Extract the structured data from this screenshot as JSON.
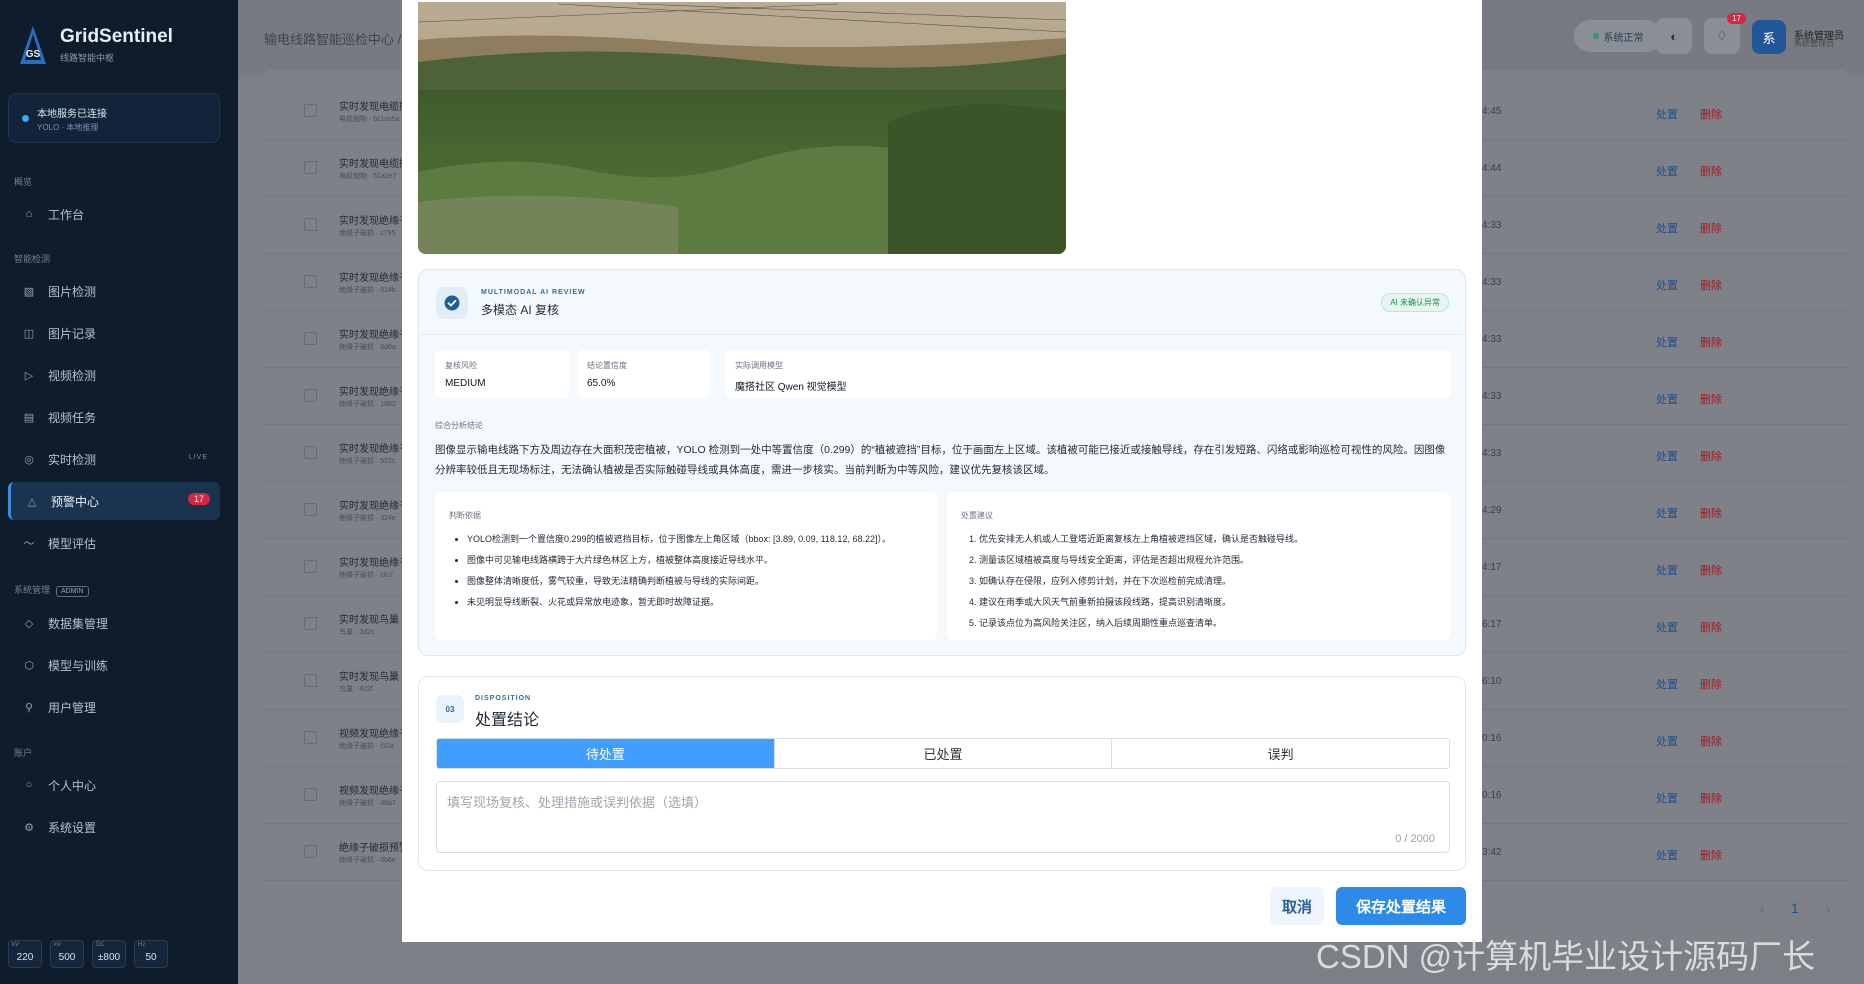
{
  "colors": {
    "accent": "#409eff",
    "sidebar_bg": "#0f1c2c",
    "danger": "#d7263d",
    "success": "#1d8a55"
  },
  "brand": {
    "logo_text": "GS",
    "name": "GridSentinel",
    "sub": "线路智能中枢"
  },
  "service": {
    "title": "本地服务已连接",
    "sub": "YOLO · 本地推理"
  },
  "sidebar": {
    "sections": [
      {
        "label": "概览"
      },
      {
        "label": "智能检测"
      },
      {
        "label": "系统管理",
        "tag": "ADMIN"
      },
      {
        "label": "账户"
      }
    ],
    "items": [
      {
        "label": "工作台",
        "icon": "home-icon"
      },
      {
        "label": "图片检测",
        "icon": "image-icon"
      },
      {
        "label": "图片记录",
        "icon": "records-icon"
      },
      {
        "label": "视频检测",
        "icon": "play-icon"
      },
      {
        "label": "视频任务",
        "icon": "tasks-icon"
      },
      {
        "label": "实时检测",
        "icon": "camera-icon",
        "tag": "LIVE"
      },
      {
        "label": "预警中心",
        "icon": "alert-icon",
        "badge": "17"
      },
      {
        "label": "模型评估",
        "icon": "trend-icon"
      },
      {
        "label": "数据集管理",
        "icon": "dataset-icon"
      },
      {
        "label": "模型与训练",
        "icon": "model-icon"
      },
      {
        "label": "用户管理",
        "icon": "user-icon"
      },
      {
        "label": "个人中心",
        "icon": "profile-icon"
      },
      {
        "label": "系统设置",
        "icon": "settings-icon"
      }
    ],
    "stats": [
      {
        "k": "kV",
        "v": "220"
      },
      {
        "k": "kV",
        "v": "500"
      },
      {
        "k": "DC",
        "v": "±800"
      },
      {
        "k": "Hz",
        "v": "50"
      }
    ]
  },
  "topbar": {
    "breadcrumb": "输电线路智能巡检中心 /",
    "status": "系统正常",
    "notif_count": "17",
    "avatar_char": "系",
    "user_name": "系统管理员",
    "user_role": "系统管理员"
  },
  "background_list": {
    "rows": [
      {
        "title": "实时发现电缆抛物",
        "sub": "电缆抛物 · bc1ce5a",
        "time": "4:45"
      },
      {
        "title": "实时发现电缆抛物",
        "sub": "电缆抛物 · 51a2e7",
        "time": "4:44"
      },
      {
        "title": "实时发现绝缘子",
        "sub": "绝缘子破损 · c795",
        "time": "4:33"
      },
      {
        "title": "实时发现绝缘子",
        "sub": "绝缘子破损 · 014b",
        "time": "4:33"
      },
      {
        "title": "实时发现绝缘子",
        "sub": "绝缘子破损 · 8d6a",
        "time": "4:33"
      },
      {
        "title": "实时发现绝缘子",
        "sub": "绝缘子破损 · 1862",
        "time": "4:33"
      },
      {
        "title": "实时发现绝缘子",
        "sub": "绝缘子破损 · 522c",
        "time": "4:33"
      },
      {
        "title": "实时发现绝缘子",
        "sub": "绝缘子破损 · 324e",
        "time": "4:29"
      },
      {
        "title": "实时发现绝缘子",
        "sub": "绝缘子破损 · cfc7",
        "time": "4:17"
      },
      {
        "title": "实时发现鸟巢",
        "sub": "鸟巢 · 3d2c",
        "time": "6:17"
      },
      {
        "title": "实时发现鸟巢",
        "sub": "鸟巢 · 422f",
        "time": "6:10"
      },
      {
        "title": "视频发现绝缘子",
        "sub": "绝缘子破损 · f10a",
        "time": "0:16"
      },
      {
        "title": "视频发现绝缘子",
        "sub": "绝缘子破损 · 48a7",
        "time": "0:16"
      },
      {
        "title": "绝缘子破损预警",
        "sub": "绝缘子破损 · 0b6e",
        "time": "3:42"
      }
    ],
    "action_label": "处置",
    "delete_label": "删除",
    "page": "1"
  },
  "modal": {
    "ai_review": {
      "eyebrow": "MULTIMODAL AI REVIEW",
      "title": "多模态 AI 复核",
      "badge": "AI 未确认异常",
      "metrics": [
        {
          "label": "复核风险",
          "value": "MEDIUM"
        },
        {
          "label": "结论置信度",
          "value": "65.0%"
        },
        {
          "label": "实际调用模型",
          "value": "魔搭社区 Qwen 视觉模型"
        }
      ],
      "summary_label": "综合分析结论",
      "summary": "图像显示输电线路下方及周边存在大面积茂密植被，YOLO 检测到一处中等置信度（0.299）的“植被遮挡”目标，位于画面左上区域。该植被可能已接近或接触导线，存在引发短路、闪络或影响巡检可视性的风险。因图像分辨率较低且无现场标注，无法确认植被是否实际触碰导线或具体高度，需进一步核实。当前判断为中等风险，建议优先复核该区域。",
      "evidence_label": "判断依据",
      "evidence": [
        "YOLO检测到一个置信度0.299的植被遮挡目标，位于图像左上角区域（bbox: [3.89, 0.09, 118.12, 68.22]）。",
        "图像中可见输电线路横跨于大片绿色林区上方，植被整体高度接近导线水平。",
        "图像整体清晰度低，雾气较重，导致无法精确判断植被与导线的实际间距。",
        "未见明显导线断裂、火花或异常放电迹象，暂无即时故障证据。"
      ],
      "advice_label": "处置建议",
      "advice": [
        "优先安排无人机或人工登塔近距离复核左上角植被遮挡区域，确认是否触碰导线。",
        "测量该区域植被高度与导线安全距离，评估是否超出规程允许范围。",
        "如确认存在侵限，应列入修剪计划，并在下次巡检前完成清理。",
        "建议在雨季或大风天气前重新拍摄该段线路，提高识别清晰度。",
        "记录该点位为高风险关注区，纳入后续周期性重点巡查清单。"
      ]
    },
    "disposition": {
      "num": "03",
      "eyebrow": "DISPOSITION",
      "title": "处置结论",
      "options": [
        "待处置",
        "已处置",
        "误判"
      ],
      "selected": "待处置",
      "note_value": "",
      "note_placeholder": "填写现场复核、处理措施或误判依据（选填）",
      "note_count": "0 / 2000"
    },
    "cancel_label": "取消",
    "save_label": "保存处置结果"
  },
  "watermark": "CSDN @计算机毕业设计源码厂长"
}
